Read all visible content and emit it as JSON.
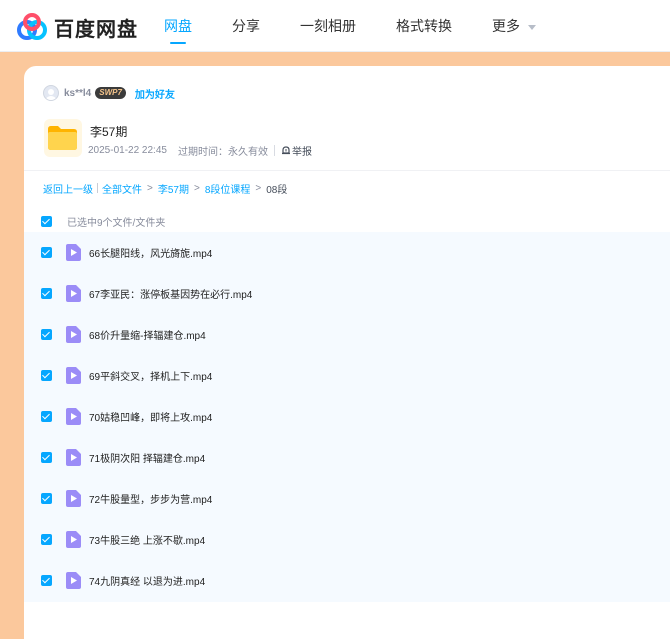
{
  "header": {
    "brand": "百度网盘",
    "nav": [
      {
        "label": "网盘",
        "active": true
      },
      {
        "label": "分享",
        "active": false
      },
      {
        "label": "一刻相册",
        "active": false
      },
      {
        "label": "格式转换",
        "active": false
      },
      {
        "label": "更多",
        "active": false,
        "dropdown": true
      }
    ]
  },
  "share": {
    "user": "ks**l4",
    "badge": "SWP7",
    "add_friend": "加为好友",
    "title": "李57期",
    "date": "2025-01-22 22:45",
    "expire": "过期时间：永久有效",
    "report": "举报"
  },
  "breadcrumb": {
    "back": "返回上一级",
    "items": [
      "全部文件",
      "李57期",
      "8段位课程"
    ],
    "current": "08段"
  },
  "list_header": {
    "selected_text": "已选中9个文件/文件夹"
  },
  "files": [
    {
      "name": "66长腿阳线，风光旖旎.mp4",
      "checked": true
    },
    {
      "name": "67李亚民：涨停板基因势在必行.mp4",
      "checked": true
    },
    {
      "name": "68价升量缩-择辐建仓.mp4",
      "checked": true
    },
    {
      "name": "69平斜交叉，择机上下.mp4",
      "checked": true
    },
    {
      "name": "70姑稳凹峰，即将上攻.mp4",
      "checked": true
    },
    {
      "name": "71极阴次阳 择辐建仓.mp4",
      "checked": true
    },
    {
      "name": "72牛股量型，步步为营.mp4",
      "checked": true
    },
    {
      "name": "73牛股三绝 上涨不歇.mp4",
      "checked": true
    },
    {
      "name": "74九阴真经 以退为进.mp4",
      "checked": true
    }
  ],
  "colors": {
    "accent": "#06a7ff",
    "page_bg": "#fbc89c",
    "list_bg": "#f5faff",
    "video_icon": "#9b8cf7"
  }
}
